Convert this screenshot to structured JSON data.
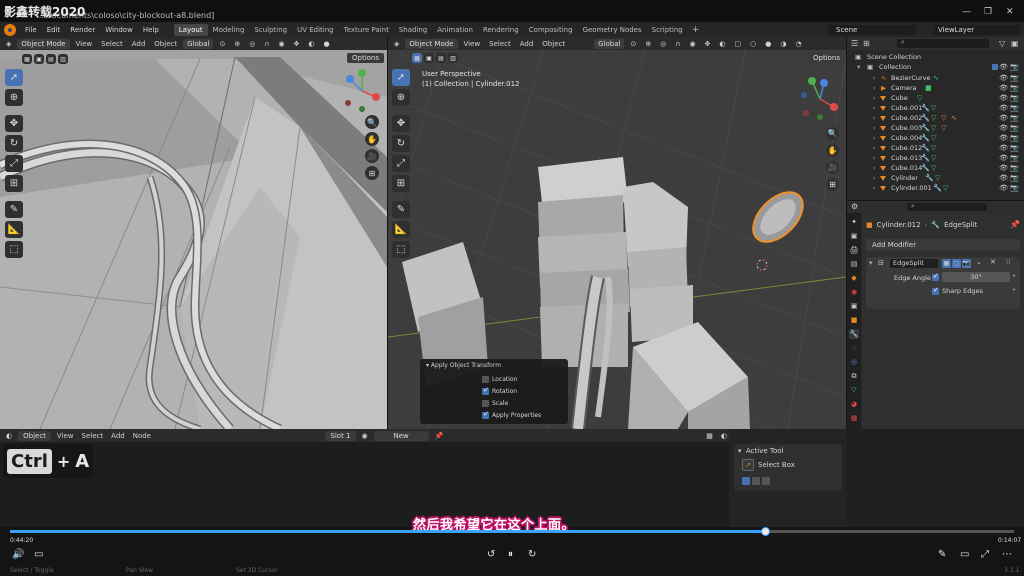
{
  "title_bar": {
    "watermark": "影鑫转载2020",
    "path": "…\\documents\\coloso\\city-blockout-a8.blend]",
    "minimize": "—",
    "maximize": "❐",
    "close": "✕"
  },
  "menu": {
    "items": [
      "File",
      "Edit",
      "Render",
      "Window",
      "Help"
    ],
    "workspaces": [
      "Layout",
      "Modeling",
      "Sculpting",
      "UV Editing",
      "Texture Paint",
      "Shading",
      "Animation",
      "Rendering",
      "Compositing",
      "Geometry Nodes",
      "Scripting"
    ],
    "active_workspace": "Layout",
    "add_workspace": "+",
    "scene": "Scene",
    "view_layer": "ViewLayer"
  },
  "left_viewport": {
    "mode": "Object Mode",
    "menus": [
      "View",
      "Select",
      "Add",
      "Object"
    ],
    "orientation": "Global",
    "options": "Options"
  },
  "right_viewport": {
    "mode": "Object Mode",
    "menus": [
      "View",
      "Select",
      "Add",
      "Object"
    ],
    "orientation": "Global",
    "options": "Options",
    "info_line1": "User Perspective",
    "info_line2": "(1) Collection | Cylinder.012"
  },
  "apply_transform_popup": {
    "title": "Apply Object Transform",
    "options": [
      {
        "label": "Location",
        "checked": false
      },
      {
        "label": "Rotation",
        "checked": true
      },
      {
        "label": "Scale",
        "checked": false
      },
      {
        "label": "Apply Properties",
        "checked": true
      }
    ]
  },
  "outliner": {
    "header": "Scene Collection",
    "collection": "Collection",
    "items": [
      "BezierCurve",
      "Camera",
      "Cube",
      "Cube.001",
      "Cube.002",
      "Cube.003",
      "Cube.004",
      "Cube.012",
      "Cube.013",
      "Cube.014",
      "Cylinder",
      "Cylinder.001"
    ]
  },
  "properties": {
    "object": "Cylinder.012",
    "modifier_tab": "EdgeSplit",
    "add_modifier": "Add Modifier",
    "modifier_name": "EdgeSplit",
    "edge_angle_label": "Edge Angle",
    "edge_angle_value": "30°",
    "sharp_edges_label": "Sharp Edges"
  },
  "timeline": {
    "mode": "Object",
    "menus": [
      "View",
      "Select",
      "Add",
      "Node"
    ],
    "slot": "Slot 1",
    "new_button": "New"
  },
  "active_tool": {
    "header": "Active Tool",
    "tool": "Select Box"
  },
  "shortcut": {
    "key1": "Ctrl",
    "plus": "+",
    "key2": "A"
  },
  "video": {
    "subtitle": "然后我希望它在这个上面。",
    "elapsed": "0:44:20",
    "total": "0:14:07",
    "progress": 0.752
  },
  "status_bar": {
    "left": "Select / Toggle",
    "middle": "Pan View",
    "right": "Set 3D Cursor",
    "version": "3.3.1"
  },
  "colors": {
    "accent": "#4772b3",
    "orange": "#e8882b",
    "green_mod": "#3ec16a",
    "blue_mod": "#5a8fd8",
    "progress": "#3aa3ff",
    "subtitle_outline": "#c01468"
  }
}
